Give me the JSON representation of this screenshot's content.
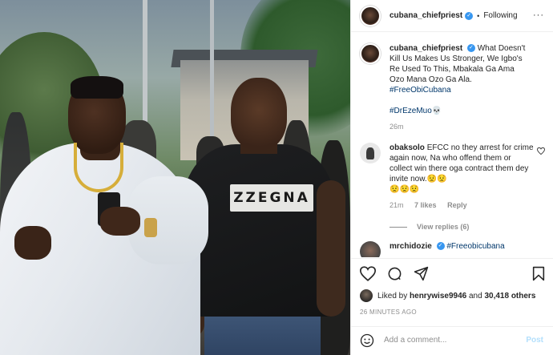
{
  "post": {
    "username": "cubana_chiefpriest",
    "verified_icon": "verified-badge-icon",
    "separator": "•",
    "follow_status": "Following",
    "more_icon": "···",
    "photo_shirt_text": "ZZEGNA"
  },
  "caption": {
    "username": "cubana_chiefpriest",
    "text": "What Doesn't Kill Us Makes Us Stronger, We Igbo's Re Used To This, Mbakala Ga Ama Ozo Mana Ozo Ga Ala.",
    "hashtag1": "#FreeObiCubana",
    "hashtag2": "#DrEzeMuo",
    "emoji": "💀",
    "time": "26m"
  },
  "comments": [
    {
      "username": "obaksolo",
      "text": "EFCC no they arrest for crime again now, Na who offend them or collect win there oga contract them dey invite now.😟😟",
      "emoji_line": "😟😟😟",
      "time": "21m",
      "likes": "7 likes",
      "reply_label": "Reply",
      "view_replies": "View replies (6)"
    },
    {
      "username": "mrchidozie",
      "text": "#Freeobicubana"
    }
  ],
  "actions": {
    "liked_by_prefix": "Liked by",
    "liked_by_user": "henrywise9946",
    "liked_by_and": "and",
    "liked_by_others": "30,418 others",
    "time_ago": "26 MINUTES AGO",
    "add_comment_placeholder": "Add a comment...",
    "post_label": "Post"
  },
  "colors": {
    "link": "#00376b",
    "verified": "#3897f0",
    "muted": "#8e8e8e",
    "post_disabled": "#b2dffc"
  }
}
